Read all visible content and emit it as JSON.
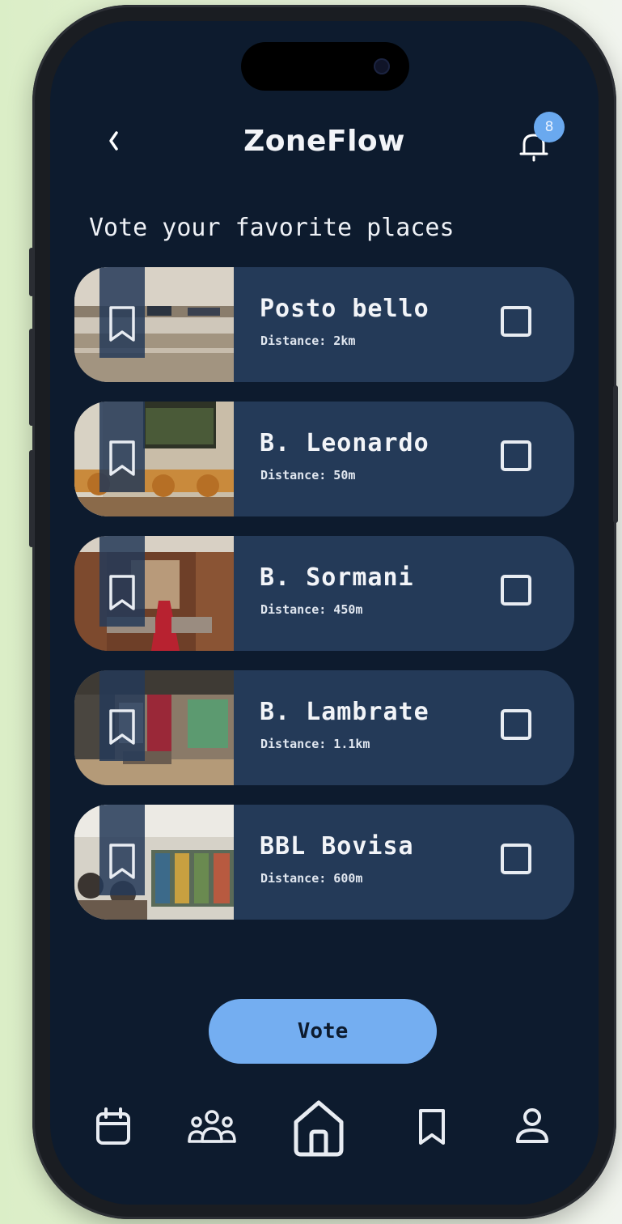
{
  "header": {
    "title": "ZoneFlow",
    "notification_count": "8"
  },
  "heading": "Vote your favorite places",
  "places": [
    {
      "name": "Posto bello",
      "distance": "Distance: 2km"
    },
    {
      "name": "B. Leonardo",
      "distance": "Distance: 50m"
    },
    {
      "name": "B. Sormani",
      "distance": "Distance: 450m"
    },
    {
      "name": "B. Lambrate",
      "distance": "Distance: 1.1km"
    },
    {
      "name": "BBL Bovisa",
      "distance": "Distance: 600m"
    }
  ],
  "vote_button": "Vote",
  "nav": [
    "calendar-icon",
    "group-icon",
    "home-icon",
    "bookmark-icon",
    "profile-icon"
  ],
  "colors": {
    "background": "#0d1b2e",
    "card": "#243a58",
    "accent": "#74aef1"
  }
}
